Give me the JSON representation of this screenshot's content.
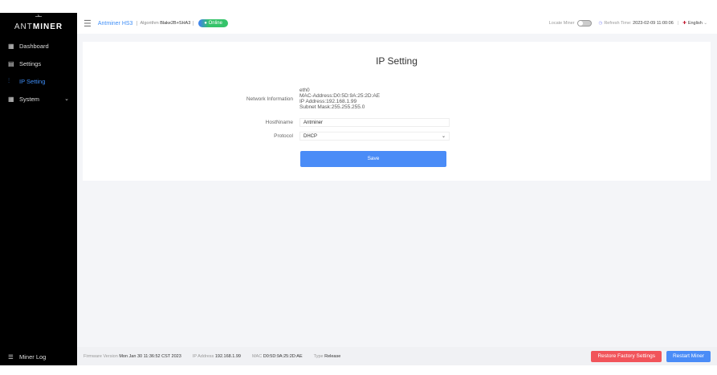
{
  "brand": {
    "mark": "⼇",
    "name_light": "ANT",
    "name_bold": "MINER"
  },
  "sidebar": {
    "items": [
      {
        "icon": "dashboard-icon",
        "label": "Dashboard"
      },
      {
        "icon": "settings-icon",
        "label": "Settings"
      },
      {
        "icon": "sliders-icon",
        "label": "IP Setting"
      },
      {
        "icon": "system-icon",
        "label": "System"
      }
    ],
    "miner_log": "Miner Log"
  },
  "header": {
    "model": "Antminer HS3",
    "algorithm_label": "Algorithm",
    "algorithm": "Blake2B+SHA3",
    "status": "Online",
    "locate_miner": "Locate Miner",
    "refresh_label": "Refresh Time:",
    "refresh_time": "2023-02-09 11:00:06",
    "language": "English"
  },
  "page": {
    "title": "IP Setting",
    "network_label": "Network Information",
    "network": {
      "iface": "eth0",
      "mac": "MAC-Address:D0:5D:9A:25:2D:AE",
      "ip": "IP Address:192.168.1.99",
      "mask": "Subnet Mask:255.255.255.0"
    },
    "hostname_label": "HostNname",
    "hostname": "Antminer",
    "protocol_label": "Protocol",
    "protocol": "DHCP",
    "save": "Save"
  },
  "footer": {
    "fw_label": "Firmware Version",
    "fw": "Mon Jan 30 11:36:52 CST 2023",
    "ip_label": "IP Address",
    "ip": "192.168.1.99",
    "mac_label": "MAC",
    "mac": "D0:5D:9A:25:2D:AE",
    "type_label": "Type",
    "type": "Release",
    "restore": "Restore Factory Settings",
    "restart": "Restart Miner"
  },
  "colors": {
    "accent": "#3e8ef7",
    "danger": "#f1545a",
    "online": "#35c36a"
  }
}
